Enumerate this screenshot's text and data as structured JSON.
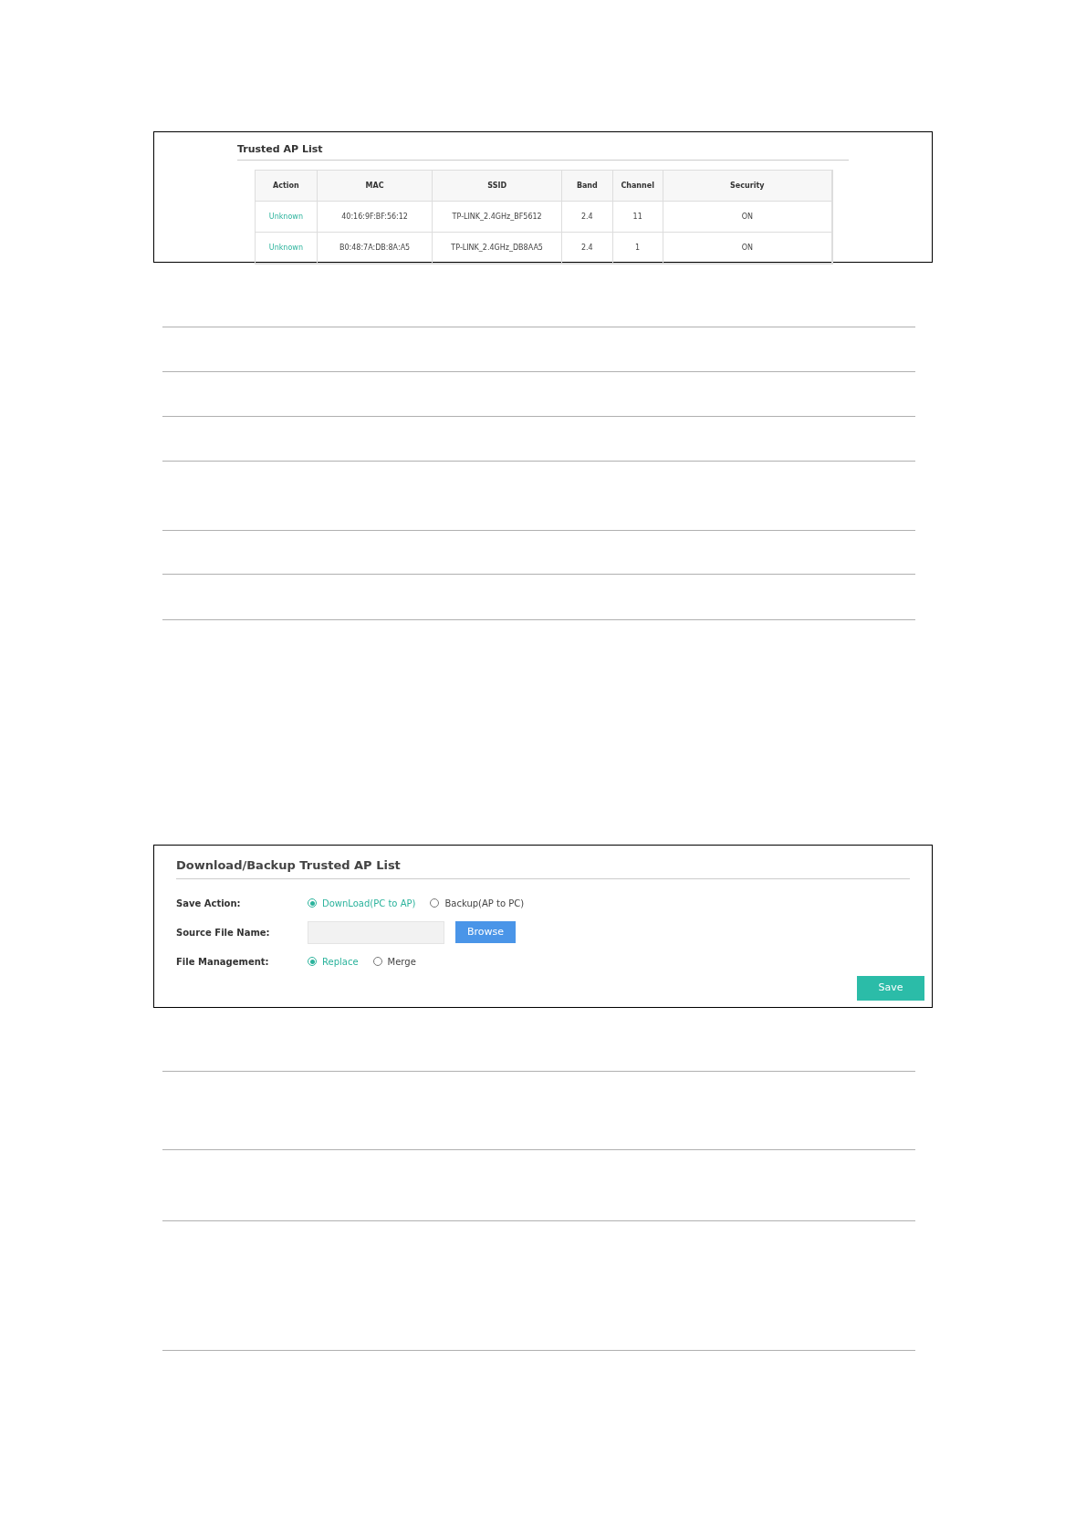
{
  "trusted_ap_list": {
    "title": "Trusted AP List",
    "columns": [
      "Action",
      "MAC",
      "SSID",
      "Band",
      "Channel",
      "Security"
    ],
    "rows": [
      {
        "action": "Unknown",
        "mac": "40:16:9F:BF:56:12",
        "ssid": "TP-LINK_2.4GHz_BF5612",
        "band": "2.4",
        "channel": "11",
        "security": "ON"
      },
      {
        "action": "Unknown",
        "mac": "B0:48:7A:DB:8A:A5",
        "ssid": "TP-LINK_2.4GHz_DB8AA5",
        "band": "2.4",
        "channel": "1",
        "security": "ON"
      }
    ]
  },
  "download_backup": {
    "title": "Download/Backup Trusted AP List",
    "save_action": {
      "label": "Save Action:",
      "options": [
        {
          "label": "DownLoad(PC to AP)",
          "selected": true
        },
        {
          "label": "Backup(AP to PC)",
          "selected": false
        }
      ]
    },
    "source_file": {
      "label": "Source File Name:",
      "button": "Browse"
    },
    "file_management": {
      "label": "File Management:",
      "options": [
        {
          "label": "Replace",
          "selected": true
        },
        {
          "label": "Merge",
          "selected": false
        }
      ]
    },
    "save_button": "Save"
  }
}
